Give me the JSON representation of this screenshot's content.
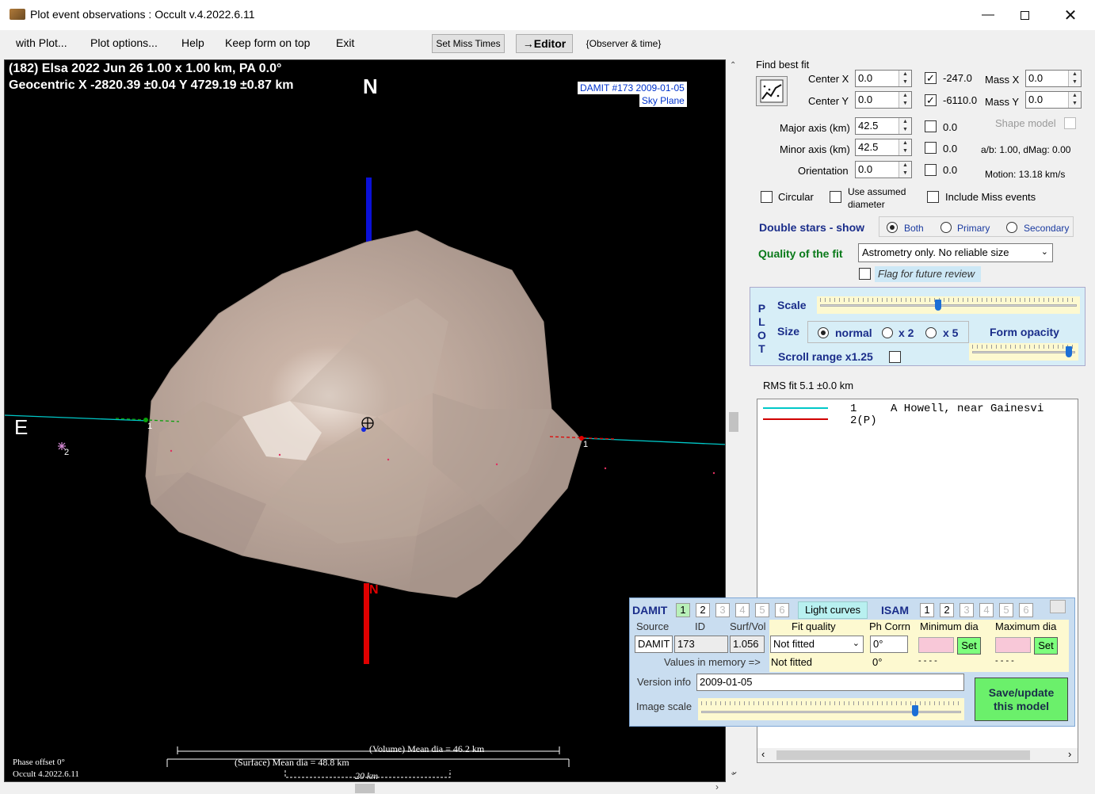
{
  "window": {
    "title": "Plot event observations : Occult v.4.2022.6.11"
  },
  "menu": [
    "with Plot...",
    "Plot options...",
    "Help",
    "Keep form on top",
    "Exit"
  ],
  "toolbar": {
    "set_miss_times": "Set Miss Times",
    "editor": "→Editor",
    "observer_time": "{Observer & time}"
  },
  "plot": {
    "header_line1": "(182) Elsa  2022 Jun 26   1.00 x 1.00 km, PA 0.0°",
    "header_line2": "Geocentric  X  -2820.39 ±0.04  Y 4729.19 ±0.87 km",
    "north_label": "N",
    "east_label": "E",
    "north_small": "N",
    "damit_line1": "DAMIT #173 2009-01-05",
    "damit_line2": "Sky Plane",
    "chord1_left": "1",
    "chord1_right": "1",
    "star2": "2",
    "phase_offset": "Phase offset 0°",
    "occult_version": "Occult 4.2022.6.11",
    "volume_dia": "(Volume) Mean dia = 46.2 km",
    "surface_dia": "(Surface) Mean dia = 48.8 km",
    "scale_20km": "20 km"
  },
  "fit": {
    "find_best_fit": "Find best fit",
    "center_x_label": "Center X",
    "center_x": "0.0",
    "center_x_chk": "-247.0",
    "center_y_label": "Center Y",
    "center_y": "0.0",
    "center_y_chk": "-6110.0",
    "mass_x_label": "Mass X",
    "mass_x": "0.0",
    "mass_y_label": "Mass Y",
    "mass_y": "0.0",
    "major_label": "Major axis (km)",
    "major": "42.5",
    "major_chk": "0.0",
    "minor_label": "Minor axis (km)",
    "minor": "42.5",
    "minor_chk": "0.0",
    "orient_label": "Orientation",
    "orient": "0.0",
    "orient_chk": "0.0",
    "shape_model": "Shape model",
    "ab_dmag": "a/b: 1.00, dMag: 0.00",
    "motion": "Motion: 13.18 km/s",
    "circular": "Circular",
    "use_assumed": "Use assumed",
    "diameter": "diameter",
    "include_miss": "Include Miss events",
    "double_stars": "Double stars - show",
    "both": "Both",
    "primary": "Primary",
    "secondary": "Secondary",
    "quality_label": "Quality of the fit",
    "quality_value": "Astrometry only. No reliable size",
    "flag_review": "Flag for future review"
  },
  "plotpanel": {
    "plot_letters": [
      "P",
      "L",
      "O",
      "T"
    ],
    "scale": "Scale",
    "size": "Size",
    "normal": "normal",
    "x2": "x 2",
    "x5": "x 5",
    "form_opacity": "Form opacity",
    "scroll_range": "Scroll range x1.25",
    "scale_value": 0.46,
    "opacity_value": 0.97
  },
  "rms": "RMS fit 5.1 ±0.0 km",
  "observers": [
    {
      "num": "1",
      "name": "A Howell, near Gainesvi",
      "color": "#00c8c8"
    },
    {
      "num": "2(P)",
      "name": "",
      "color": "#d00000"
    }
  ],
  "damit": {
    "damit_title": "DAMIT",
    "damit_nums": [
      "1",
      "2",
      "3",
      "4",
      "5",
      "6"
    ],
    "light_curves": "Light curves",
    "isam_title": "ISAM",
    "isam_nums": [
      "1",
      "2",
      "3",
      "4",
      "5",
      "6"
    ],
    "source_h": "Source",
    "id_h": "ID",
    "surfvol_h": "Surf/Vol",
    "fitq_h": "Fit quality",
    "phcorr_h": "Ph Corrn",
    "mindia_h": "Minimum dia",
    "maxdia_h": "Maximum dia",
    "source": "DAMIT",
    "id": "173",
    "surfvol": "1.056",
    "fitq": "Not fitted",
    "phcorr": "0°",
    "set": "Set",
    "values_mem": "Values in memory =>",
    "mem_fitq": "Not fitted",
    "mem_phcorr": "0°",
    "mem_min": "- - - -",
    "mem_max": "- - - -",
    "version_label": "Version info",
    "version": "2009-01-05",
    "image_scale": "Image scale",
    "save_line1": "Save/update",
    "save_line2": "this model",
    "image_scale_value": 0.83
  }
}
